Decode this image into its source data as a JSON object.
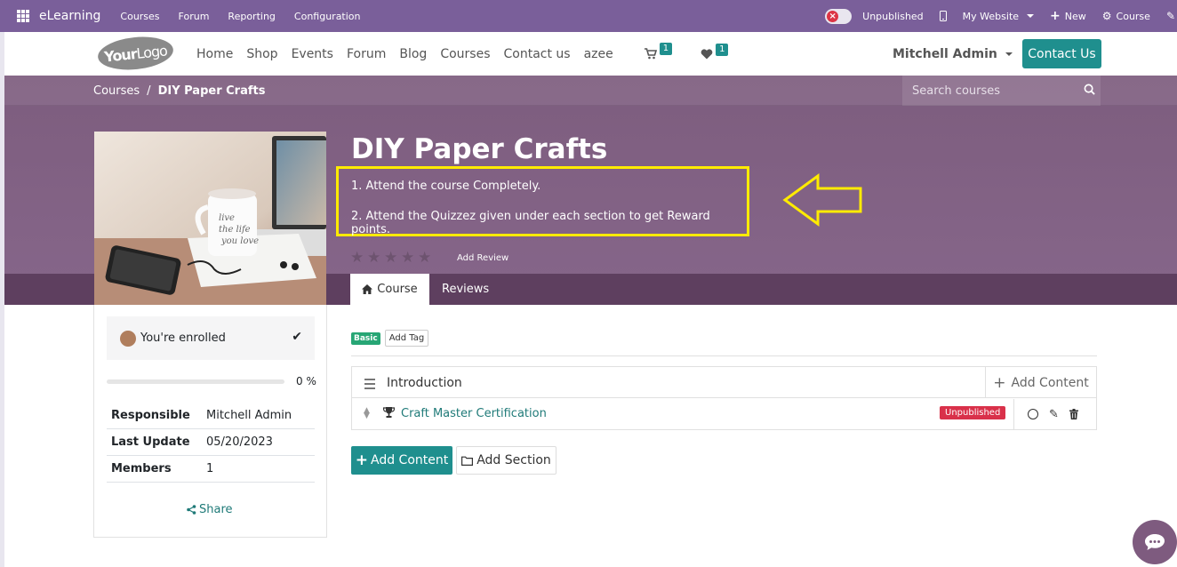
{
  "admin_bar": {
    "brand": "eLearning",
    "menu": [
      "Courses",
      "Forum",
      "Reporting",
      "Configuration"
    ],
    "publish_status": "Unpublished",
    "website": "My Website",
    "new": "New",
    "course": "Course"
  },
  "header": {
    "logo_bold": "Your",
    "logo_light": "Logo",
    "nav": [
      "Home",
      "Shop",
      "Events",
      "Forum",
      "Blog",
      "Courses",
      "Contact us",
      "azee"
    ],
    "cart_count": "1",
    "wishlist_count": "1",
    "user": "Mitchell Admin",
    "contact_button": "Contact Us"
  },
  "breadcrumb": {
    "parent": "Courses",
    "separator": "/",
    "current": "DIY Paper Crafts"
  },
  "search": {
    "placeholder": "Search courses"
  },
  "course": {
    "title": "DIY Paper Crafts",
    "description_lines": [
      "1. Attend the course Completely.",
      "2. Attend the Quizzez given under each section to get Reward points."
    ],
    "rating_stars": 5,
    "add_review": "Add Review",
    "tabs": [
      "Course",
      "Reviews"
    ]
  },
  "sidebar": {
    "enrolled": "You're enrolled",
    "progress_value": 0,
    "progress_label": "0 %",
    "info": [
      {
        "key": "Responsible",
        "value": "Mitchell Admin"
      },
      {
        "key": "Last Update",
        "value": "05/20/2023"
      },
      {
        "key": "Members",
        "value": "1"
      }
    ],
    "share": "Share"
  },
  "main": {
    "tag": "Basic",
    "add_tag": "Add Tag",
    "section_title": "Introduction",
    "section_add_content": "Add Content",
    "slide_title": "Craft Master Certification",
    "slide_status": "Unpublished",
    "add_content": "Add Content",
    "add_section": "Add Section"
  },
  "colors": {
    "admin_bar": "#7a5f9a",
    "accent": "#1f8f8e",
    "course_header": "#7d5d7e",
    "highlight": "#ffeb00",
    "danger": "#d9314a",
    "success": "#27a675"
  }
}
